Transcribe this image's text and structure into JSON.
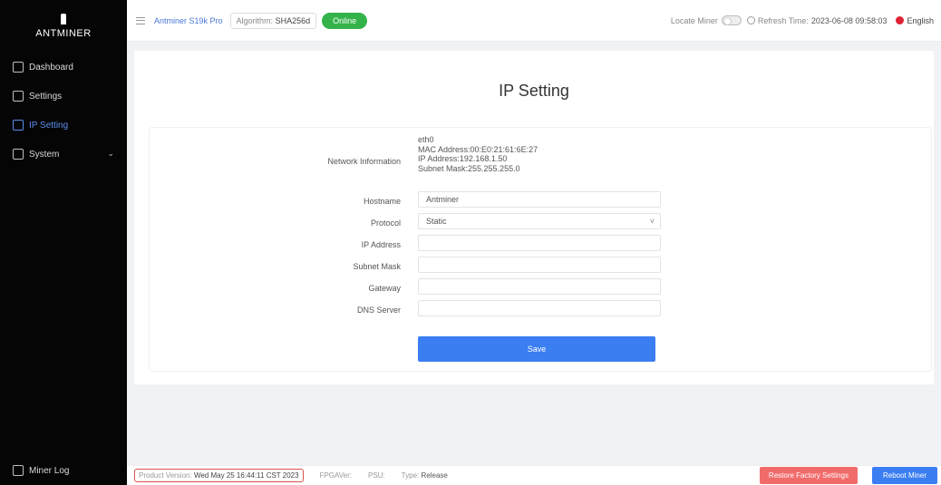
{
  "brand": {
    "logo_text": "ANTMINER"
  },
  "sidebar": {
    "items": [
      {
        "label": "Dashboard",
        "icon": "dashboard-icon"
      },
      {
        "label": "Settings",
        "icon": "settings-icon"
      },
      {
        "label": "IP Setting",
        "icon": "ip-setting-icon",
        "active": true
      },
      {
        "label": "System",
        "icon": "system-icon"
      }
    ],
    "miner_log": "Miner Log"
  },
  "header": {
    "model": "Antminer S19k Pro",
    "algorithm_label": "Algorithm:",
    "algorithm_value": "SHA256d",
    "status": "Online",
    "locate_label": "Locate Miner",
    "refresh_label": "Refresh Time:",
    "refresh_value": "2023-06-08 09:58:03",
    "language": "English"
  },
  "page": {
    "title": "IP Setting",
    "network_info_label": "Network Information",
    "network_info_lines": [
      "eth0",
      "MAC Address:00:E0:21:61:6E:27",
      "IP Address:192.168.1.50",
      "Subnet Mask:255.255.255.0"
    ],
    "hostname_label": "Hostname",
    "hostname_value": "Antminer",
    "protocol_label": "Protocol",
    "protocol_value": "Static",
    "ip_label": "IP Address",
    "subnet_label": "Subnet Mask",
    "gateway_label": "Gateway",
    "dns_label": "DNS Server",
    "save_label": "Save"
  },
  "footer": {
    "version_label": "Product Version:",
    "version_value": "Wed May 25 16:44:11 CST 2023",
    "fw_label": "FPGAVer:",
    "psu_label": "PSU:",
    "type_label": "Type:",
    "type_value": "Release",
    "restore_label": "Restore Factory Settings",
    "reboot_label": "Reboot Miner"
  },
  "colors": {
    "accent": "#3a7ef2",
    "online": "#34b34a",
    "danger": "#f26b6b",
    "sidebar_bg": "#050505"
  }
}
